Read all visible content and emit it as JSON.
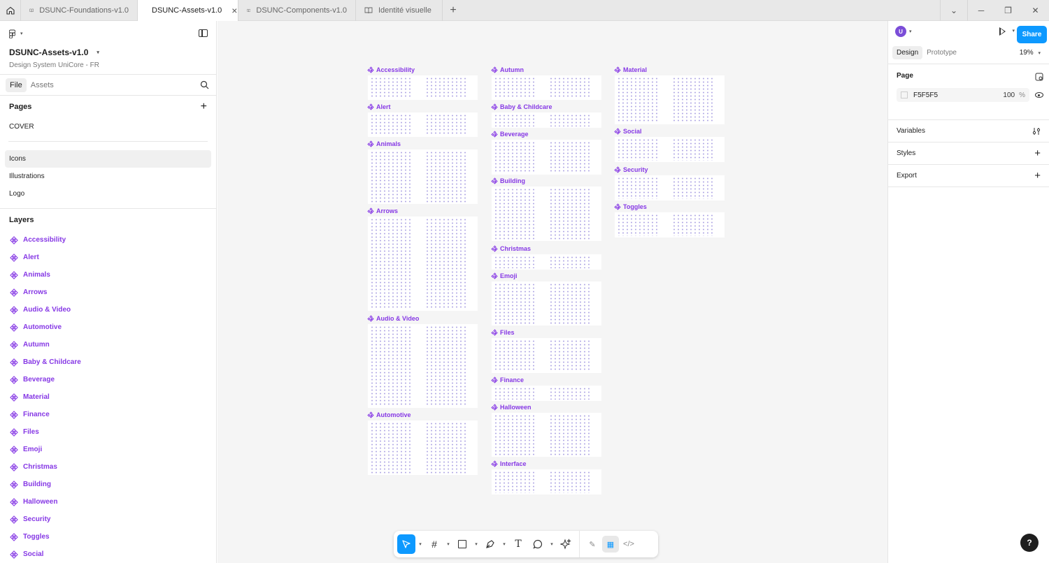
{
  "tabs": [
    {
      "label": "DSUNC-Foundations-v1.0",
      "active": false
    },
    {
      "label": "DSUNC-Assets-v1.0",
      "active": true
    },
    {
      "label": "DSUNC-Components-v1.0",
      "active": false
    },
    {
      "label": "Identité visuelle",
      "active": false
    }
  ],
  "project": {
    "title": "DSUNC-Assets-v1.0",
    "subtitle": "Design System UniCore - FR"
  },
  "file_tabs": {
    "file": "File",
    "assets": "Assets"
  },
  "pages": {
    "heading": "Pages",
    "items": [
      "COVER",
      "Icons",
      "Illustrations",
      "Logo"
    ],
    "selected": "Icons"
  },
  "layers": {
    "heading": "Layers",
    "items": [
      "Accessibility",
      "Alert",
      "Animals",
      "Arrows",
      "Audio & Video",
      "Automotive",
      "Autumn",
      "Baby & Childcare",
      "Beverage",
      "Material",
      "Finance",
      "Files",
      "Emoji",
      "Christmas",
      "Building",
      "Halloween",
      "Security",
      "Toggles",
      "Social"
    ]
  },
  "canvas": {
    "background": "#F5F5F5",
    "frames": [
      {
        "name": "Accessibility"
      },
      {
        "name": "Alert"
      },
      {
        "name": "Animals"
      },
      {
        "name": "Arrows"
      },
      {
        "name": "Audio & Video"
      },
      {
        "name": "Automotive"
      },
      {
        "name": "Autumn"
      },
      {
        "name": "Baby & Childcare"
      },
      {
        "name": "Beverage"
      },
      {
        "name": "Building"
      },
      {
        "name": "Christmas"
      },
      {
        "name": "Emoji"
      },
      {
        "name": "Files"
      },
      {
        "name": "Finance"
      },
      {
        "name": "Halloween"
      },
      {
        "name": "Interface"
      },
      {
        "name": "Material"
      },
      {
        "name": "Social"
      },
      {
        "name": "Security"
      },
      {
        "name": "Toggles"
      }
    ]
  },
  "right_panel": {
    "share": "Share",
    "tabs": {
      "design": "Design",
      "prototype": "Prototype"
    },
    "zoom": "19%",
    "page_label": "Page",
    "bg_color": "F5F5F5",
    "bg_opacity": "100",
    "opacity_unit": "%",
    "variables": "Variables",
    "styles": "Styles",
    "export": "Export",
    "help": "?"
  },
  "colors": {
    "accent": "#0d99ff",
    "component": "#8638e5"
  }
}
